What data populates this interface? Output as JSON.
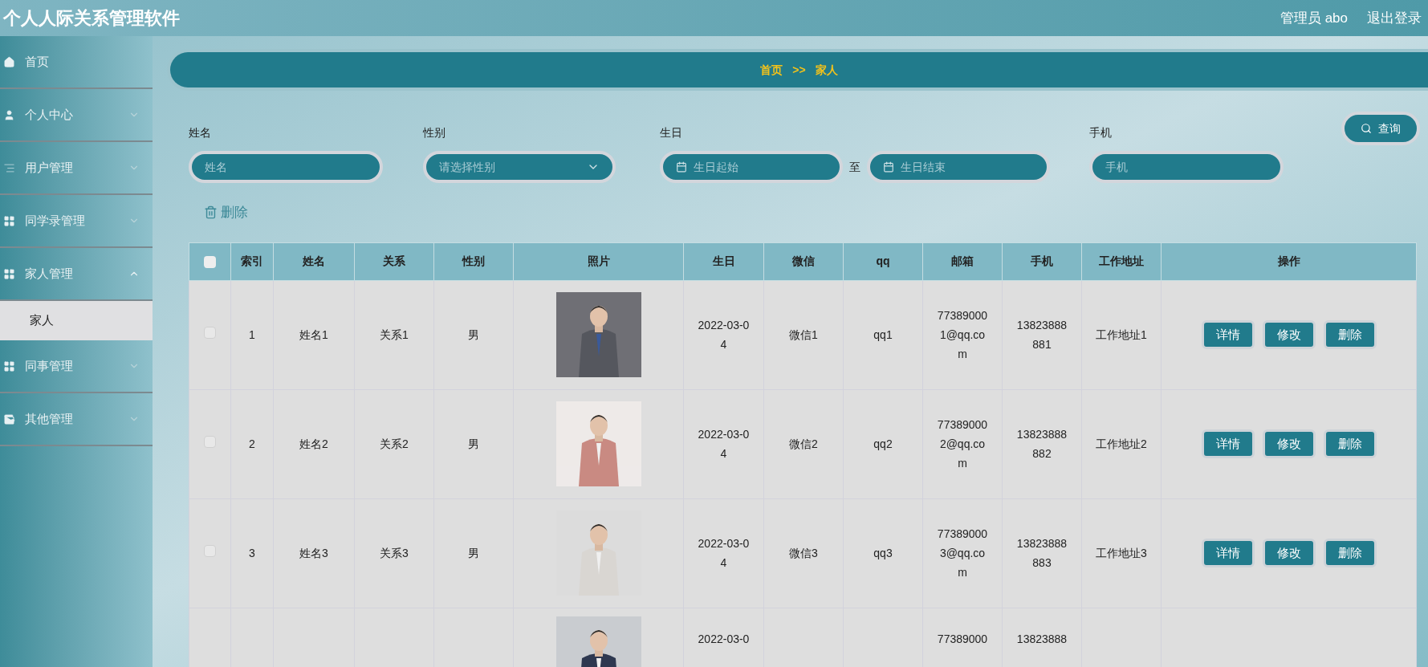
{
  "header": {
    "title": "个人人际关系管理软件",
    "user": "管理员 abo",
    "logout": "退出登录"
  },
  "sidebar": {
    "items": [
      {
        "label": "首页"
      },
      {
        "label": "个人中心",
        "expanded": false
      },
      {
        "label": "用户管理",
        "expanded": false
      },
      {
        "label": "同学录管理",
        "expanded": false
      },
      {
        "label": "家人管理",
        "expanded": true,
        "children": [
          {
            "label": "家人",
            "selected": true
          }
        ]
      },
      {
        "label": "同事管理",
        "expanded": false
      },
      {
        "label": "其他管理",
        "expanded": false
      }
    ]
  },
  "breadcrumb": [
    "首页",
    ">>",
    "家人"
  ],
  "filters": {
    "name": {
      "label": "姓名",
      "placeholder": "姓名"
    },
    "gender": {
      "label": "性别",
      "placeholder": "请选择性别"
    },
    "birthday": {
      "label": "生日",
      "start_placeholder": "生日起始",
      "separator": "至",
      "end_placeholder": "生日结束"
    },
    "phone": {
      "label": "手机",
      "placeholder": "手机"
    },
    "search_button": "查询"
  },
  "delete_button": "删除",
  "table": {
    "select_all_checked": false,
    "columns": [
      "索引",
      "姓名",
      "关系",
      "性别",
      "照片",
      "生日",
      "微信",
      "qq",
      "邮箱",
      "手机",
      "工作地址",
      "操作"
    ],
    "rows": [
      {
        "kind": "full",
        "checked": false,
        "index": "1",
        "name": "姓名1",
        "relation": "关系1",
        "gender": "男",
        "photo": {
          "kind": "picture"
        },
        "birthday": "2022-03-04",
        "wechat": "微信1",
        "qq": "qq1",
        "email": "773890001@qq.com",
        "phone": "13823888881",
        "address": "工作地址1",
        "actions": [
          "详情",
          "修改",
          "删除"
        ]
      },
      {
        "kind": "full",
        "checked": false,
        "index": "2",
        "name": "姓名2",
        "relation": "关系2",
        "gender": "男",
        "photo": {
          "kind": "picture"
        },
        "birthday": "2022-03-04",
        "wechat": "微信2",
        "qq": "qq2",
        "email": "773890002@qq.com",
        "phone": "13823888882",
        "address": "工作地址2",
        "actions": [
          "详情",
          "修改",
          "删除"
        ]
      },
      {
        "kind": "full",
        "checked": false,
        "index": "3",
        "name": "姓名3",
        "relation": "关系3",
        "gender": "男",
        "photo": {
          "kind": "picture"
        },
        "birthday": "2022-03-04",
        "wechat": "微信3",
        "qq": "qq3",
        "email": "773890003@qq.com",
        "phone": "13823888883",
        "address": "工作地址3",
        "actions": [
          "详情",
          "修改",
          "删除"
        ]
      },
      {
        "kind": "partial",
        "photo": {
          "kind": "picture"
        },
        "birthday": "2022-03-0",
        "email": "77389000",
        "phone": "13823888"
      }
    ]
  }
}
